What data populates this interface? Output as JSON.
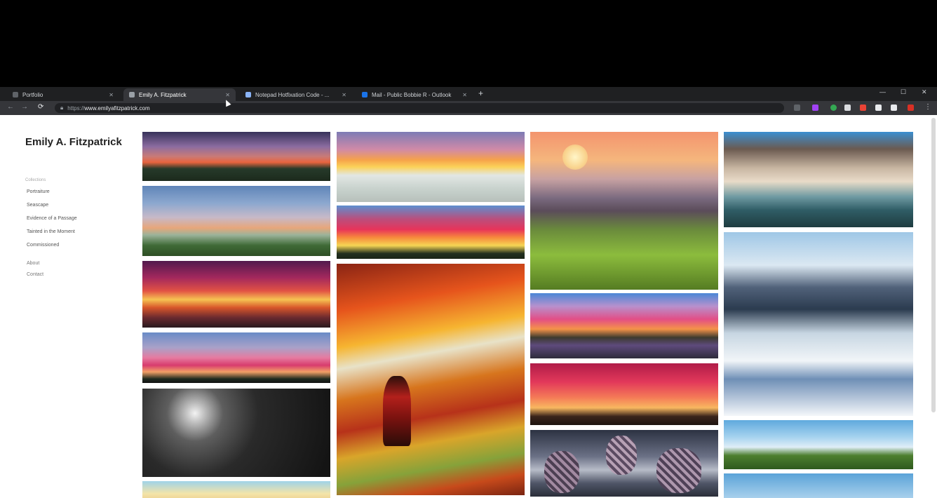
{
  "browser": {
    "tabs": [
      {
        "label": "Portfolio",
        "active": false
      },
      {
        "label": "Emily A. Fitzpatrick",
        "active": true
      },
      {
        "label": "Notepad Hotfixation Code - ...",
        "active": false
      },
      {
        "label": "Mail - Public Bobbie R - Outlook",
        "active": false
      }
    ],
    "url_protocol": "https://",
    "url": "www.emilyafitzpatrick.com"
  },
  "site": {
    "title": "Emily A. Fitzpatrick",
    "nav_section_label": "Collections",
    "nav_items": [
      "Portraiture",
      "Seascape",
      "Evidence of a Passage",
      "Tainted in the Moment",
      "Commissioned"
    ],
    "secondary_nav": [
      "About",
      "Contact"
    ]
  },
  "gallery": [
    {
      "name": "dusk-mountains-painting"
    },
    {
      "name": "cloudy-field-painting"
    },
    {
      "name": "magenta-sunset-painting"
    },
    {
      "name": "pink-horizon-painting"
    },
    {
      "name": "moonlit-night-painting"
    },
    {
      "name": "sunny-sky-painting"
    },
    {
      "name": "icebergs-sunset-painting"
    },
    {
      "name": "fiery-sky-painting"
    },
    {
      "name": "autumn-umbrella-painting"
    },
    {
      "name": "mountain-children-painting"
    },
    {
      "name": "lake-sunset-painting"
    },
    {
      "name": "red-sky-tree-painting"
    },
    {
      "name": "pinecones-painting"
    },
    {
      "name": "storm-clouds-sea-painting"
    },
    {
      "name": "snowy-valley-painting"
    },
    {
      "name": "green-meadow-painting"
    },
    {
      "name": "blue-sky-painting"
    }
  ]
}
